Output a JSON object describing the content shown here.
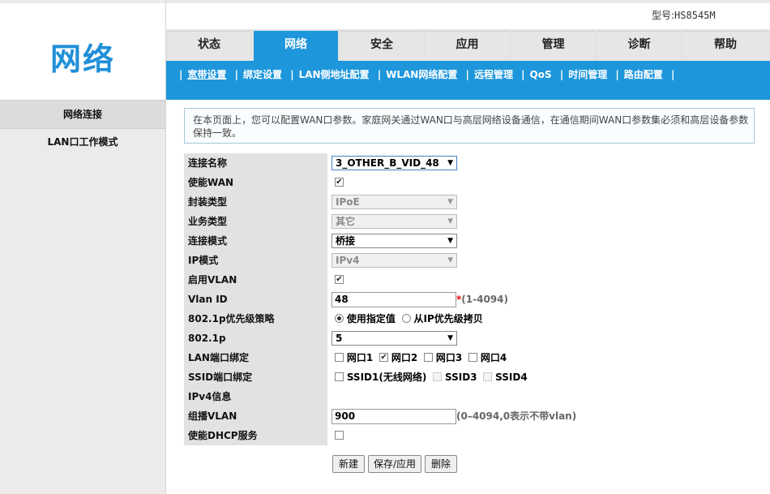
{
  "app": {
    "logo": "网络",
    "model_label": "型号:",
    "model_value": "HS8545M"
  },
  "tabs": [
    {
      "label": "状态"
    },
    {
      "label": "网络"
    },
    {
      "label": "安全"
    },
    {
      "label": "应用"
    },
    {
      "label": "管理"
    },
    {
      "label": "诊断"
    },
    {
      "label": "帮助"
    }
  ],
  "subnav": [
    "宽带设置",
    "绑定设置",
    "LAN侧地址配置",
    "WLAN网络配置",
    "远程管理",
    "QoS",
    "时间管理",
    "路由配置"
  ],
  "sidebar": {
    "items": [
      {
        "label": "网络连接"
      },
      {
        "label": "LAN口工作模式"
      }
    ]
  },
  "info_text": "在本页面上，您可以配置WAN口参数。家庭网关通过WAN口与高层网络设备通信，在通信期间WAN口参数集必须和高层设备参数保持一致。",
  "form": {
    "connection_name": {
      "label": "连接名称",
      "value": "3_OTHER_B_VID_48"
    },
    "enable_wan": {
      "label": "使能WAN",
      "checked": true
    },
    "encap_type": {
      "label": "封装类型",
      "value": "IPoE"
    },
    "service_type": {
      "label": "业务类型",
      "value": "其它"
    },
    "connection_mode": {
      "label": "连接模式",
      "value": "桥接"
    },
    "ip_mode": {
      "label": "IP模式",
      "value": "IPv4"
    },
    "enable_vlan": {
      "label": "启用VLAN",
      "checked": true
    },
    "vlan_id": {
      "label": "Vlan ID",
      "value": "48",
      "required_mark": "*",
      "hint": "(1-4094)"
    },
    "priority_policy": {
      "label": "802.1p优先级策略",
      "option_specified": "使用指定值",
      "option_copy": "从IP优先级拷贝",
      "selected": "specified"
    },
    "priority": {
      "label": "802.1p",
      "value": "5"
    },
    "lan_binding": {
      "label": "LAN端口绑定",
      "ports": [
        {
          "label": "网口1",
          "checked": false
        },
        {
          "label": "网口2",
          "checked": true
        },
        {
          "label": "网口3",
          "checked": false
        },
        {
          "label": "网口4",
          "checked": false
        }
      ]
    },
    "ssid_binding": {
      "label": "SSID端口绑定",
      "ssids": [
        {
          "label": "SSID1(无线网络)",
          "checked": false,
          "disabled": false
        },
        {
          "label": "SSID3",
          "checked": false,
          "disabled": true
        },
        {
          "label": "SSID4",
          "checked": false,
          "disabled": true
        }
      ]
    },
    "ipv4_info": {
      "label": "IPv4信息"
    },
    "multicast_vlan": {
      "label": "组播VLAN",
      "value": "900",
      "hint": "(0–4094,0表示不带vlan)"
    },
    "enable_dhcp": {
      "label": "使能DHCP服务",
      "checked": false
    }
  },
  "buttons": {
    "new": "新建",
    "save": "保存/应用",
    "delete": "删除"
  }
}
